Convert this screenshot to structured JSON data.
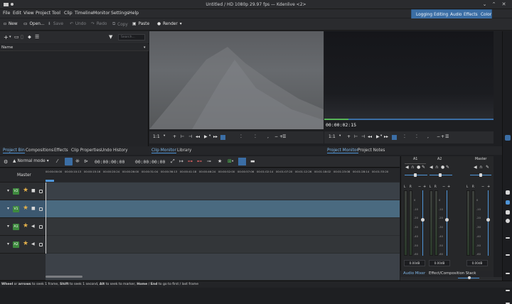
{
  "window": {
    "title": "Untitled / HD 1080p 29.97 fps — Kdenlive <2>"
  },
  "menu": [
    "File",
    "Edit",
    "View",
    "Project",
    "Tool",
    "Clip",
    "Timeline",
    "Monitor",
    "Settings",
    "Help"
  ],
  "toolbar": {
    "new": "New",
    "open": "Open...",
    "save": "Save",
    "undo": "Undo",
    "redo": "Redo",
    "copy": "Copy",
    "paste": "Paste",
    "render": "Render"
  },
  "layouts": [
    "Logging",
    "Editing",
    "Audio",
    "Effects",
    "Color"
  ],
  "bin": {
    "search_placeholder": "Search...",
    "column_name": "Name"
  },
  "clip_monitor": {
    "zoom": "1:1",
    "timecode": "00:00:02:15"
  },
  "project_monitor": {
    "zoom": "1:1"
  },
  "tabs_left": [
    "Project Bin",
    "Compositions",
    "Effects",
    "Clip Properties",
    "Undo History"
  ],
  "tabs_middle": [
    "Clip Monitor",
    "Library"
  ],
  "tabs_right": [
    "Project Monitor",
    "Project Notes"
  ],
  "timeline": {
    "mode": "Normal mode",
    "timecode": "00:00:00:00",
    "timecode2": "00:00:00:00",
    "master_label": "Master",
    "ruler": [
      "00:00:00:00",
      "00:00:10:13",
      "00:00:15:16",
      "00:00:20:24",
      "00:00:26:00",
      "00:00:31:04",
      "00:00:36:13",
      "00:00:41:18",
      "00:00:46:24",
      "00:00:52:00",
      "00:00:57:06",
      "00:01:02:14",
      "00:01:07:20",
      "00:01:12:26",
      "00:01:18:02",
      "00:01:23:08",
      "00:01:28:14",
      "00:01:33:20"
    ],
    "tracks": [
      {
        "label": "V2"
      },
      {
        "label": "V1"
      },
      {
        "label": "A1"
      },
      {
        "label": "A2"
      }
    ]
  },
  "mixer": {
    "channels": [
      {
        "name": "A1",
        "db": "0.00dB"
      },
      {
        "name": "A2",
        "db": "0.00dB"
      },
      {
        "name": "Master",
        "db": "0.00dB"
      }
    ],
    "scale": [
      "0",
      "-10",
      "-20",
      "-30",
      "-40",
      "-50",
      "-60"
    ],
    "tabs": [
      "Audio Mixer",
      "Effect/Composition Stack"
    ]
  },
  "status": {
    "k1": "Wheel",
    "t1": " or ",
    "k2": "arrows",
    "t2": " to seek 1 frame, ",
    "k3": "Shift",
    "t3": " to seek 1 second, ",
    "k4": "Alt",
    "t4": " to seek to marker, ",
    "k5": "Home",
    "t5": " / ",
    "k6": "End",
    "t6": " to go to first / last frame"
  },
  "colors": {
    "accent": "#3b6ea5",
    "track_video": "#3e8a3e",
    "track_audio": "#3e8a3e",
    "selection": "#4f95d8"
  }
}
